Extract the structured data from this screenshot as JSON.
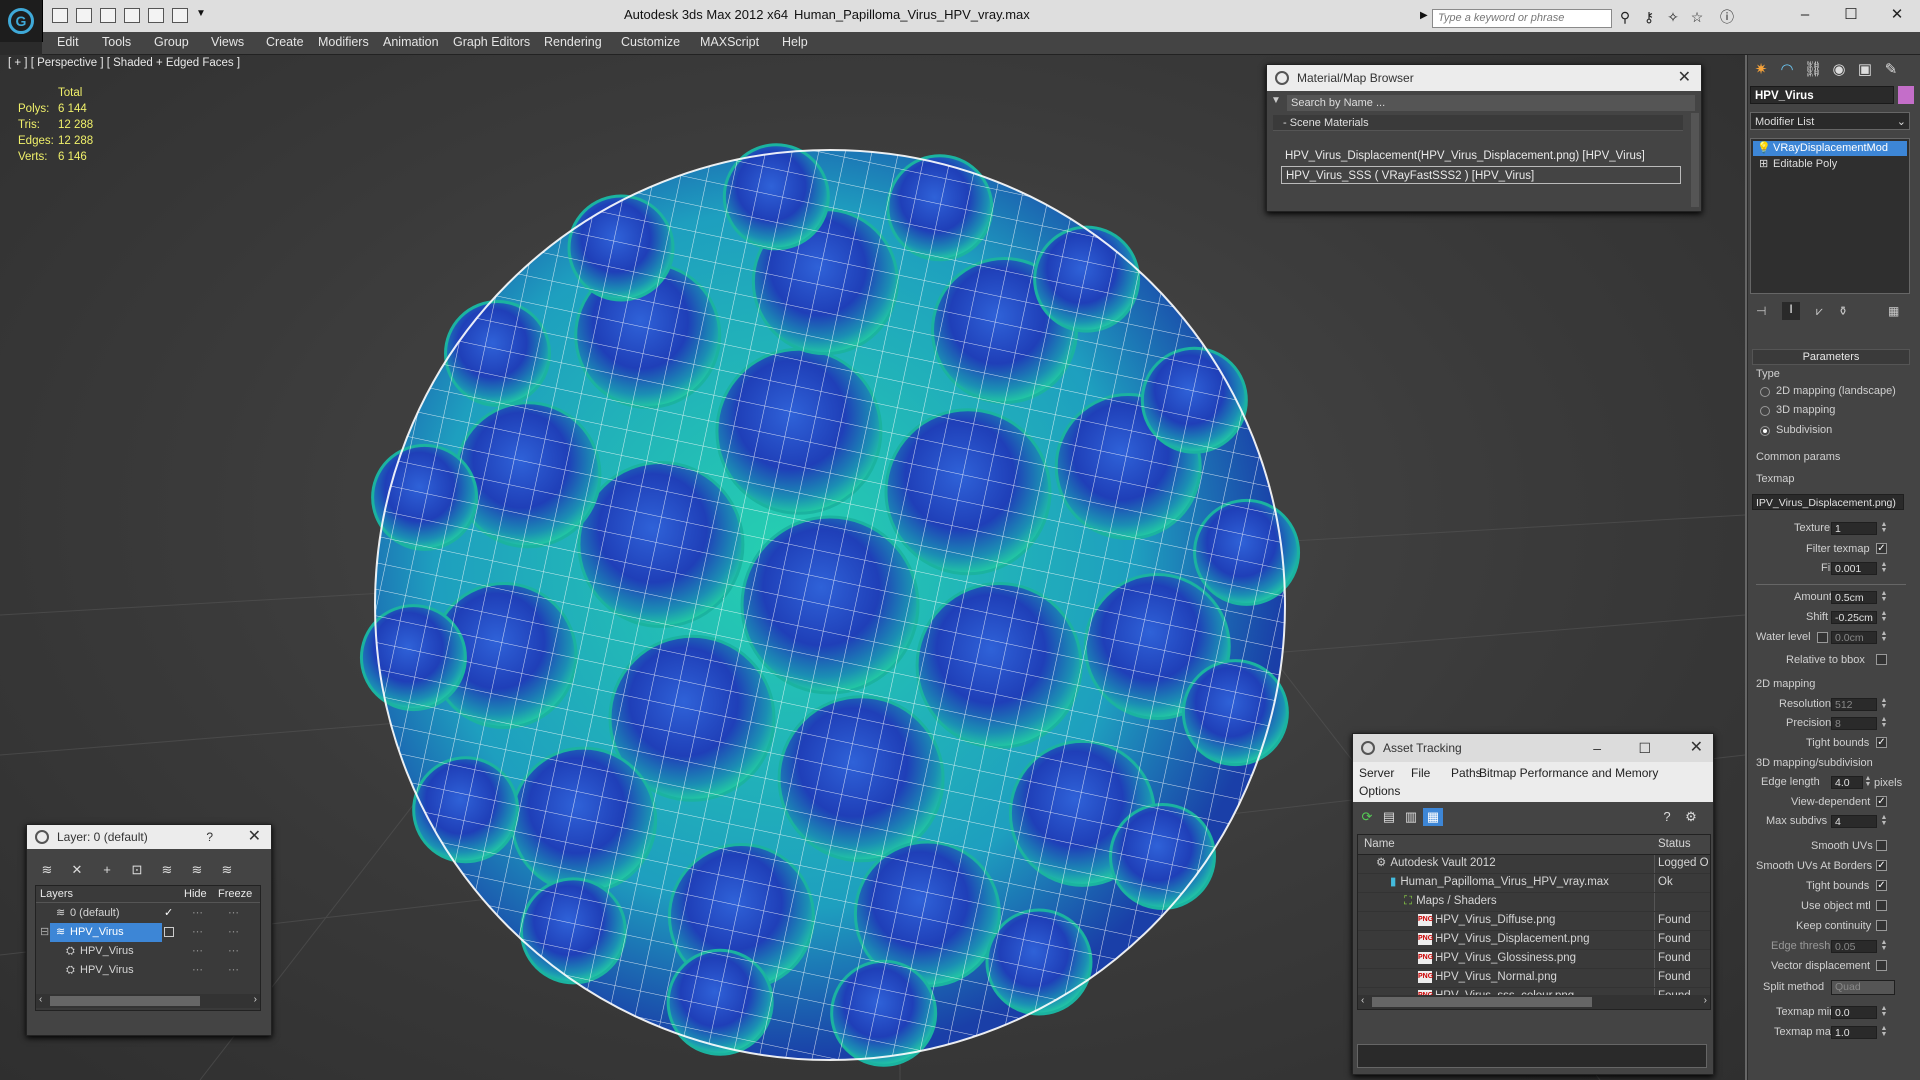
{
  "window": {
    "title": "Autodesk 3ds Max  2012 x64",
    "file": "Human_Papilloma_Virus_HPV_vray.max",
    "search_placeholder": "Type a keyword or phrase"
  },
  "menu": [
    "Edit",
    "Tools",
    "Group",
    "Views",
    "Create",
    "Modifiers",
    "Animation",
    "Graph Editors",
    "Rendering",
    "Customize",
    "MAXScript",
    "Help"
  ],
  "viewport": {
    "label": "[ + ] [ Perspective ] [ Shaded + Edged Faces ]",
    "stats": {
      "header": "Total",
      "rows": [
        {
          "label": "Polys:",
          "value": "6 144"
        },
        {
          "label": "Tris:",
          "value": "12 288"
        },
        {
          "label": "Edges:",
          "value": "12 288"
        },
        {
          "label": "Verts:",
          "value": "6 146"
        }
      ]
    }
  },
  "material_browser": {
    "title": "Material/Map Browser",
    "search": "Search by Name ...",
    "section": "- Scene Materials",
    "items": [
      "HPV_Virus_Displacement(HPV_Virus_Displacement.png) [HPV_Virus]",
      "HPV_Virus_SSS  ( VRayFastSSS2 )  [HPV_Virus]"
    ]
  },
  "command_panel": {
    "object_name": "HPV_Virus",
    "object_color": "#c46ec9",
    "modifier_list": "Modifier List",
    "stack": [
      "VRayDisplacementMod",
      "Editable Poly"
    ],
    "parameters_head": "Parameters",
    "type_label": "Type",
    "type_options": [
      {
        "label": "2D mapping (landscape)",
        "selected": false
      },
      {
        "label": "3D mapping",
        "selected": false
      },
      {
        "label": "Subdivision",
        "selected": true
      }
    ],
    "common_params": "Common params",
    "texmap_label": "Texmap",
    "texmap_value": "IPV_Virus_Displacement.png)",
    "texture_chan": {
      "label": "Texture chan",
      "value": "1"
    },
    "filter_texmap": {
      "label": "Filter texmap",
      "checked": true
    },
    "filter_blur": {
      "label": "Filter blur",
      "value": "0.001"
    },
    "amount": {
      "label": "Amount",
      "value": "0.5cm"
    },
    "shift": {
      "label": "Shift",
      "value": "-0.25cm"
    },
    "water_level": {
      "label": "Water level",
      "value": "0.0cm"
    },
    "relative_bbox": {
      "label": "Relative to bbox",
      "checked": false
    },
    "mapping2d_head": "2D mapping",
    "resolution": {
      "label": "Resolution",
      "value": "512"
    },
    "precision": {
      "label": "Precision",
      "value": "8"
    },
    "tight_bounds_2d": {
      "label": "Tight bounds",
      "checked": true
    },
    "subdiv_head": "3D mapping/subdivision",
    "edge_length": {
      "label": "Edge length",
      "value": "4.0",
      "unit": "pixels"
    },
    "view_dependent": {
      "label": "View-dependent",
      "checked": true
    },
    "max_subdivs": {
      "label": "Max subdivs",
      "value": "4"
    },
    "smooth_uvs": {
      "label": "Smooth UVs",
      "checked": false
    },
    "smooth_uvs_borders": {
      "label": "Smooth UVs At Borders",
      "checked": true
    },
    "tight_bounds_3d": {
      "label": "Tight bounds",
      "checked": true
    },
    "use_object_mtl": {
      "label": "Use object mtl",
      "checked": false
    },
    "keep_continuity": {
      "label": "Keep continuity",
      "checked": false
    },
    "edge_thresh": {
      "label": "Edge thresh",
      "value": "0.05"
    },
    "vector_disp": {
      "label": "Vector displacement",
      "checked": false
    },
    "split_method": {
      "label": "Split method",
      "value": "Quad"
    },
    "texmap_min": {
      "label": "Texmap min",
      "value": "0.0"
    },
    "texmap_max": {
      "label": "Texmap max",
      "value": "1.0"
    }
  },
  "layers": {
    "title": "Layer: 0 (default)",
    "help": "?",
    "headers": {
      "name": "Layers",
      "hide": "Hide",
      "freeze": "Freeze"
    },
    "rows": [
      {
        "name": "0 (default)",
        "indent": 1,
        "selected": false
      },
      {
        "name": "HPV_Virus",
        "indent": 1,
        "selected": true
      },
      {
        "name": "HPV_Virus",
        "indent": 2,
        "selected": false
      },
      {
        "name": "HPV_Virus",
        "indent": 2,
        "selected": false
      }
    ]
  },
  "asset_tracking": {
    "title": "Asset Tracking",
    "menu": [
      "Server",
      "File",
      "Paths",
      "Bitmap Performance and Memory",
      "Options"
    ],
    "headers": {
      "name": "Name",
      "status": "Status"
    },
    "rows": [
      {
        "name": "Autodesk Vault 2012",
        "status": "Logged O",
        "indent": 1,
        "icon": "vault"
      },
      {
        "name": "Human_Papilloma_Virus_HPV_vray.max",
        "status": "Ok",
        "indent": 2,
        "icon": "max"
      },
      {
        "name": "Maps / Shaders",
        "status": "",
        "indent": 3,
        "icon": "maps"
      },
      {
        "name": "HPV_Virus_Diffuse.png",
        "status": "Found",
        "indent": 4,
        "icon": "png"
      },
      {
        "name": "HPV_Virus_Displacement.png",
        "status": "Found",
        "indent": 4,
        "icon": "png"
      },
      {
        "name": "HPV_Virus_Glossiness.png",
        "status": "Found",
        "indent": 4,
        "icon": "png"
      },
      {
        "name": "HPV_Virus_Normal.png",
        "status": "Found",
        "indent": 4,
        "icon": "png"
      },
      {
        "name": "HPV_Virus_sss_colour.png",
        "status": "Found",
        "indent": 4,
        "icon": "png"
      }
    ]
  }
}
